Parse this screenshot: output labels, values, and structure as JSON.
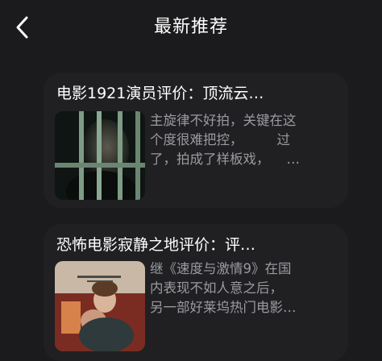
{
  "header": {
    "title": "最新推荐",
    "back_icon": "chevron-left-icon"
  },
  "articles": [
    {
      "title": "电影1921演员评价：顶流云…",
      "summary_lines": [
        "主旋律不好拍，关键在这",
        "个度很难把控，        过",
        "了，拍成了样板戏，    …"
      ],
      "thumbnail": "prison-bars-man-thumbnail"
    },
    {
      "title": "恐怖电影寂静之地评价：评…",
      "summary_lines": [
        "继《速度与激情9》在国",
        "内表现不如人意之后，",
        "另一部好莱坞热门电影…"
      ],
      "thumbnail": "a-quiet-place-poster-thumbnail"
    }
  ],
  "colors": {
    "background": "#1b1b1d",
    "card": "#202023",
    "summary_text": "#9a9aa0"
  }
}
